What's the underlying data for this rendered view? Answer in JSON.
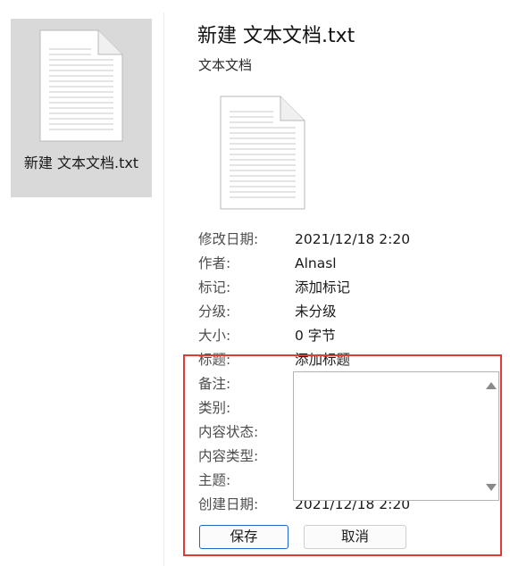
{
  "file_tile": {
    "name": "新建 文本文档.txt",
    "icon": "text-file-icon"
  },
  "details": {
    "title": "新建 文本文档.txt",
    "type": "文本文档",
    "preview_icon": "text-file-icon"
  },
  "properties": {
    "modified_label": "修改日期:",
    "modified_value": "2021/12/18 2:20",
    "author_label": "作者:",
    "author_value": "Alnasl",
    "tags_label": "标记:",
    "tags_value": "添加标记",
    "rating_label": "分级:",
    "rating_value": "未分级",
    "size_label": "大小:",
    "size_value": "0 字节",
    "title_label": "标题:",
    "title_value": "添加标题",
    "comments_label": "备注:",
    "comments_value": "",
    "category_label": "类别:",
    "content_status_label": "内容状态:",
    "content_type_label": "内容类型:",
    "subject_label": "主题:",
    "created_label": "创建日期:",
    "created_value": "2021/12/18 2:20"
  },
  "buttons": {
    "save": "保存",
    "cancel": "取消"
  },
  "colors": {
    "highlight": "#e53935",
    "tile_background": "#d9d9d9",
    "save_border": "#1e66c8"
  }
}
